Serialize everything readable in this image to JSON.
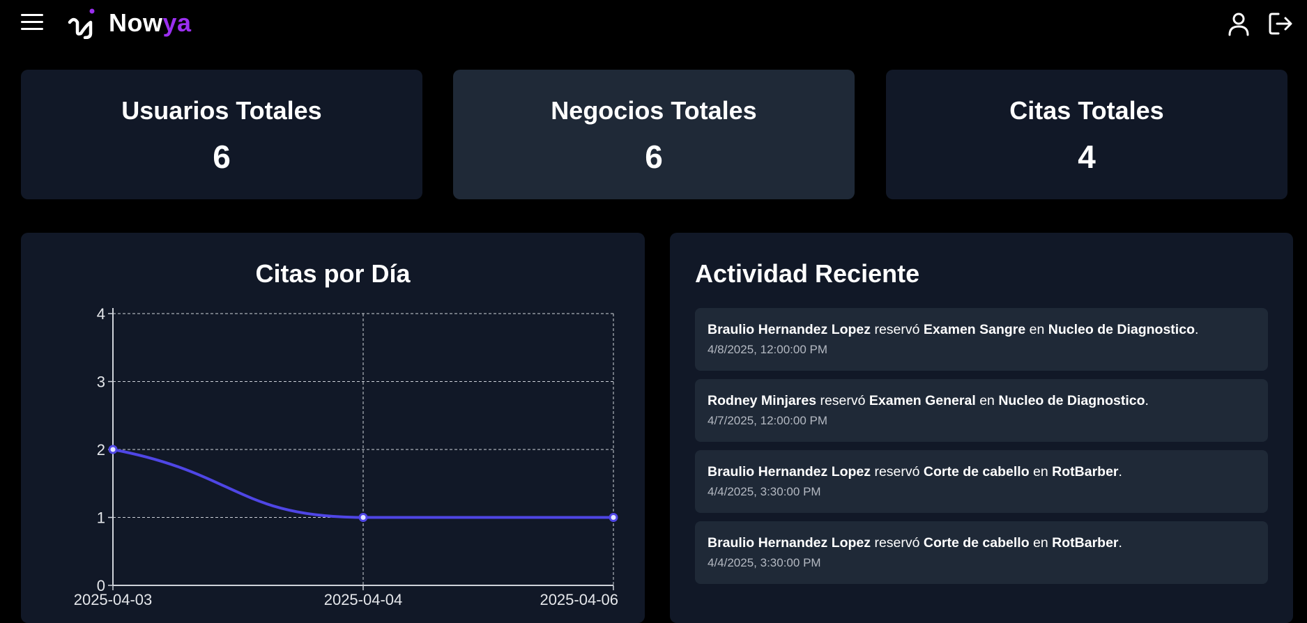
{
  "app": {
    "brand_main": "Now",
    "brand_accent": "ya"
  },
  "colors": {
    "accent": "#9b2ff0",
    "line": "#4f46e5",
    "card": "#111827",
    "card_alt": "#1f2937"
  },
  "icons": {
    "menu": "hamburger-icon",
    "logo": "nowya-logo",
    "user": "user-icon",
    "logout": "logout-icon"
  },
  "stats": [
    {
      "label": "Usuarios Totales",
      "value": "6"
    },
    {
      "label": "Negocios Totales",
      "value": "6"
    },
    {
      "label": "Citas Totales",
      "value": "4"
    }
  ],
  "chart": {
    "title": "Citas por Día"
  },
  "chart_data": {
    "type": "line",
    "title": "Citas por Día",
    "x": [
      "2025-04-03",
      "2025-04-04",
      "2025-04-06"
    ],
    "y": [
      2,
      1,
      1
    ],
    "ylim": [
      0,
      4
    ],
    "yticks": [
      "0",
      "1",
      "2",
      "3",
      "4"
    ],
    "grid": true,
    "xlabel": "",
    "ylabel": ""
  },
  "activity": {
    "title": "Actividad Reciente",
    "items": [
      {
        "user": "Braulio Hernandez Lopez",
        "verb": "reservó",
        "service": "Examen Sangre",
        "prep": "en",
        "business": "Nucleo de Diagnostico",
        "end": ".",
        "time": "4/8/2025, 12:00:00 PM"
      },
      {
        "user": "Rodney Minjares",
        "verb": "reservó",
        "service": "Examen General",
        "prep": "en",
        "business": "Nucleo de Diagnostico",
        "end": ".",
        "time": "4/7/2025, 12:00:00 PM"
      },
      {
        "user": "Braulio Hernandez Lopez",
        "verb": "reservó",
        "service": "Corte de cabello",
        "prep": "en",
        "business": "RotBarber",
        "end": ".",
        "time": "4/4/2025, 3:30:00 PM"
      },
      {
        "user": "Braulio Hernandez Lopez",
        "verb": "reservó",
        "service": "Corte de cabello",
        "prep": "en",
        "business": "RotBarber",
        "end": ".",
        "time": "4/4/2025, 3:30:00 PM"
      }
    ]
  }
}
